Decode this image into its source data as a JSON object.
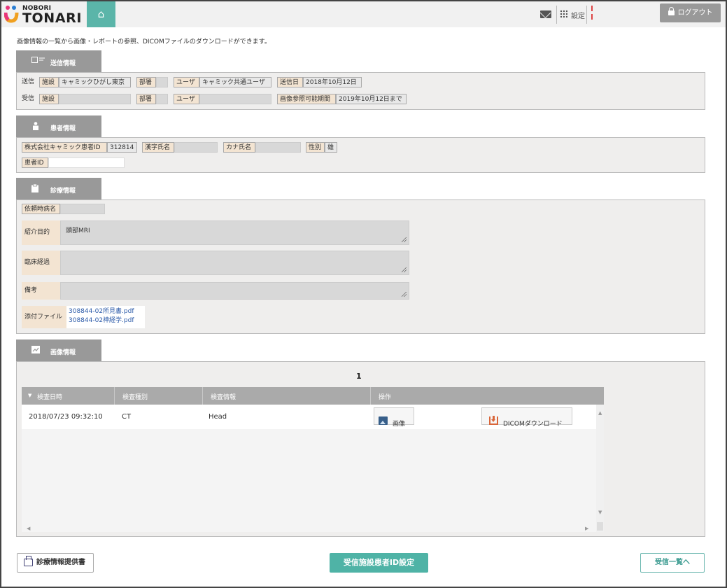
{
  "header": {
    "brand_small": "NOBORI",
    "brand_big": "TONARI",
    "home_icon": "⌂",
    "settings_label": "設定",
    "logout_label": "ログアウト"
  },
  "intro": "画像情報の一覧から画像・レポートの参照、DICOMファイルのダウンロードができます。",
  "sections": {
    "send": "送信情報",
    "patient": "患者情報",
    "clinical": "診療情報",
    "image": "画像情報"
  },
  "send_info": {
    "send_row": {
      "label": "送信",
      "facility_label": "施設",
      "facility_value": "キャミックひがし東京",
      "dept_label": "部署",
      "dept_value": "",
      "user_label": "ユーザ",
      "user_value": "キャミック共通ユーザ",
      "date_label": "送信日",
      "date_value": "2018年10月12日"
    },
    "recv_row": {
      "label": "受信",
      "facility_label": "施設",
      "facility_value": "",
      "dept_label": "部署",
      "dept_value": "",
      "user_label": "ユーザ",
      "user_value": "",
      "period_label": "画像参照可能期間",
      "period_value": "2019年10月12日まで"
    }
  },
  "patient_info": {
    "patient_id_label": "株式会社キャミック患者ID",
    "patient_id_value": "312814",
    "kanji_label": "漢字氏名",
    "kanji_value": "",
    "kana_label": "カナ氏名",
    "kana_value": "",
    "sex_label": "性別",
    "sex_value": "雄",
    "local_id_label": "患者ID",
    "local_id_value": ""
  },
  "clinical_info": {
    "disease_label": "依頼時病名",
    "disease_value": "",
    "purpose_label": "紹介目的",
    "purpose_value": "頭部MRI",
    "course_label": "臨床経過",
    "course_value": "",
    "notes_label": "備考",
    "notes_value": "",
    "attach_label": "添付ファイル",
    "attachments": [
      "308844-02所見書.pdf",
      "308844-02神経学.pdf"
    ]
  },
  "image_info": {
    "page": "1",
    "columns": [
      "検査日時",
      "検査種別",
      "検査情報",
      "操作"
    ],
    "rows": [
      {
        "datetime": "2018/07/23 09:32:10",
        "modality": "CT",
        "info": "Head",
        "image_button": "画像",
        "dicom_button": "DICOMダウンロード"
      }
    ]
  },
  "footer": {
    "provide_button": "診療情報提供書",
    "set_id_button": "受信施設患者ID設定",
    "list_button": "受信一覧へ"
  },
  "colors": {
    "accent": "#4fb3a6",
    "section_tab": "#999999",
    "label_bg": "#f3e4d2",
    "link": "#2b5aa8"
  }
}
